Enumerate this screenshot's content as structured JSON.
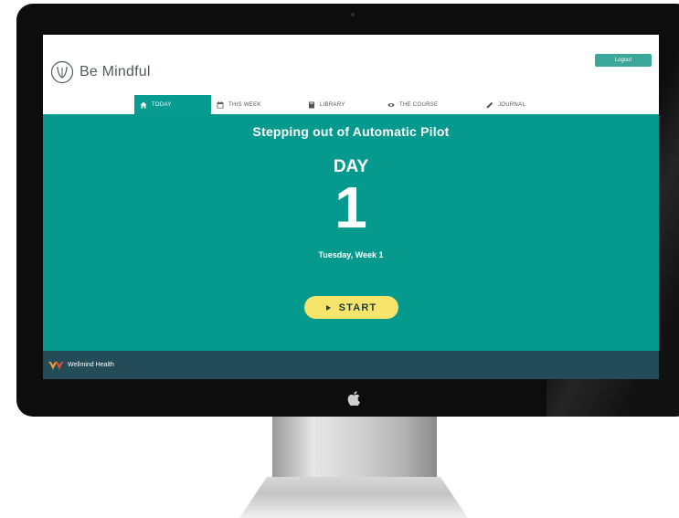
{
  "app": {
    "name": "Be Mindful",
    "logout_label": "Logout",
    "accent_color": "#069a8f",
    "start_color": "#f7e56b"
  },
  "nav": {
    "tabs": [
      {
        "label": "TODAY",
        "icon": "home-icon",
        "active": true
      },
      {
        "label": "THIS WEEK",
        "icon": "calendar-icon",
        "active": false
      },
      {
        "label": "LIBRARY",
        "icon": "book-icon",
        "active": false
      },
      {
        "label": "THE COURSE",
        "icon": "eye-icon",
        "active": false
      },
      {
        "label": "JOURNAL",
        "icon": "pencil-icon",
        "active": false
      }
    ]
  },
  "hero": {
    "title": "Stepping out of Automatic Pilot",
    "day_label": "DAY",
    "day_number": "1",
    "date_text": "Tuesday, Week 1",
    "start_label": "START"
  },
  "footer": {
    "brand": "Wellmind Health"
  }
}
